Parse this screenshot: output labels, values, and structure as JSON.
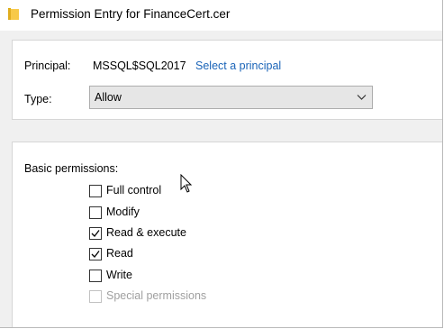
{
  "window": {
    "title": "Permission Entry for FinanceCert.cer",
    "icon": "folder-icon"
  },
  "principal": {
    "label": "Principal:",
    "value": "MSSQL$SQL2017",
    "select_link": "Select a principal"
  },
  "type": {
    "label": "Type:",
    "selected": "Allow"
  },
  "basic_permissions": {
    "label": "Basic permissions:",
    "items": [
      {
        "label": "Full control",
        "checked": false,
        "enabled": true
      },
      {
        "label": "Modify",
        "checked": false,
        "enabled": true
      },
      {
        "label": "Read & execute",
        "checked": true,
        "enabled": true
      },
      {
        "label": "Read",
        "checked": true,
        "enabled": true
      },
      {
        "label": "Write",
        "checked": false,
        "enabled": true
      },
      {
        "label": "Special permissions",
        "checked": false,
        "enabled": false
      }
    ]
  },
  "colors": {
    "link": "#1a64b8",
    "window_bg": "#f0f0f0",
    "panel_bg": "#ffffff",
    "disabled_text": "#a0a0a0"
  }
}
